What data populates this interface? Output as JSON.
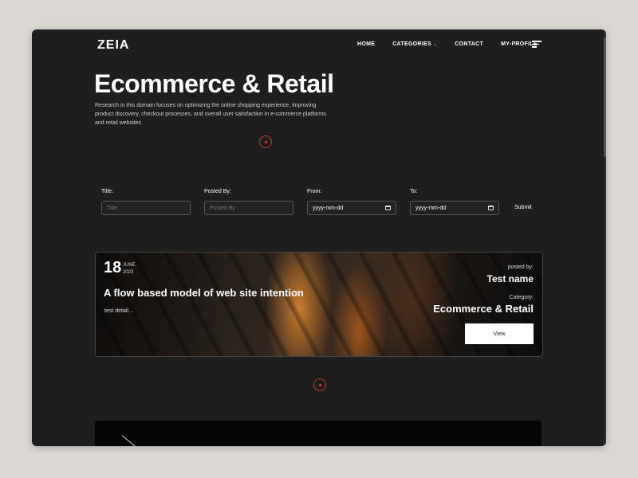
{
  "brand": {
    "logo_text": "ZEIA"
  },
  "nav": {
    "items": [
      {
        "label": "HOME"
      },
      {
        "label": "CATEGORIES",
        "has_dropdown": true
      },
      {
        "label": "CONTACT"
      },
      {
        "label": "MY-PROFILE"
      }
    ]
  },
  "hero": {
    "title": "Ecommerce & Retail",
    "description": "Research in this domain focuses on optimizing the online shopping experience, improving product discovery, checkout processes, and overall user satisfaction in e-commerce platforms and retail websites"
  },
  "filter": {
    "title_label": "Title:",
    "title_placeholder": "Title",
    "posted_by_label": "Posted By:",
    "posted_by_placeholder": "Posted By",
    "from_label": "From:",
    "from_value": "yyyy-mm-dd",
    "to_label": "To:",
    "to_value": "yyyy-mm-dd",
    "submit_label": "Submit"
  },
  "posts": [
    {
      "day": "18",
      "month": "JUNE",
      "year": "2023",
      "title": "A flow based model of web site intention",
      "detail": "test detail...",
      "posted_by_label": "posted by:",
      "posted_by": "Test name",
      "category_label": "Category:",
      "category": "Ecommerce & Retail",
      "view_label": "View"
    }
  ],
  "colors": {
    "background": "#1e1e1e",
    "accent": "#c0392b",
    "text": "#ffffff",
    "button_bg": "#ffffff"
  },
  "icons": [
    "hamburger-menu-icon",
    "chevron-down-icon",
    "calendar-icon",
    "scroll-indicator-icon"
  ]
}
